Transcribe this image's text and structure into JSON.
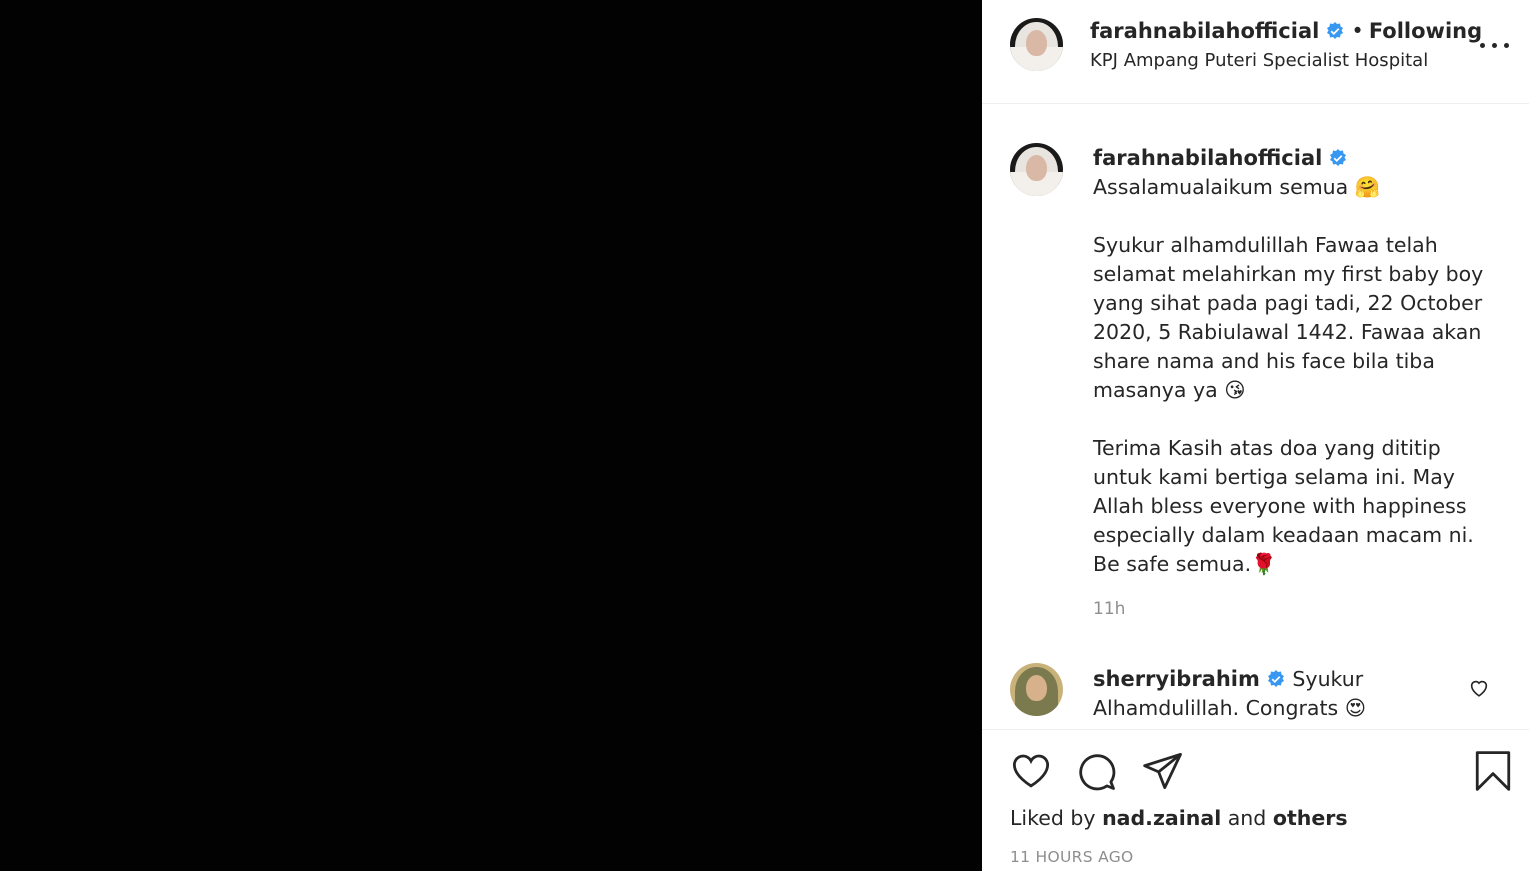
{
  "post": {
    "author": "farahnabilahofficial",
    "separator": "•",
    "follow_state": "Following",
    "location": "KPJ Ampang Puteri Specialist Hospital",
    "more_label": "More options"
  },
  "caption": {
    "author": "farahnabilahofficial",
    "paragraphs": [
      "Assalamualaikum semua 🤗",
      "Syukur alhamdulillah Fawaa telah selamat melahirkan my first baby boy yang sihat pada pagi tadi, 22 October 2020, 5 Rabiulawal 1442. Fawaa akan share nama and his face bila tiba masanya ya 😘",
      "Terima Kasih atas doa yang dititip untuk kami bertiga selama ini. May Allah bless everyone with happiness especially dalam keadaan macam ni. Be safe semua.🌹"
    ],
    "time": "11h"
  },
  "comments": [
    {
      "author": "sherryibrahim",
      "text": "Syukur Alhamdulillah. Congrats 😍"
    }
  ],
  "actions": {
    "icons": [
      "heart-icon",
      "comment-icon",
      "share-icon",
      "bookmark-icon"
    ]
  },
  "likes": {
    "prefix": "Liked by",
    "user": "nad.zainal",
    "and": "and",
    "others": "others"
  },
  "timestamp": "11 HOURS AGO",
  "colors": {
    "verified": "#3897f0",
    "text": "#262626",
    "muted": "#8e8e8e",
    "media_bg": "#020202"
  }
}
